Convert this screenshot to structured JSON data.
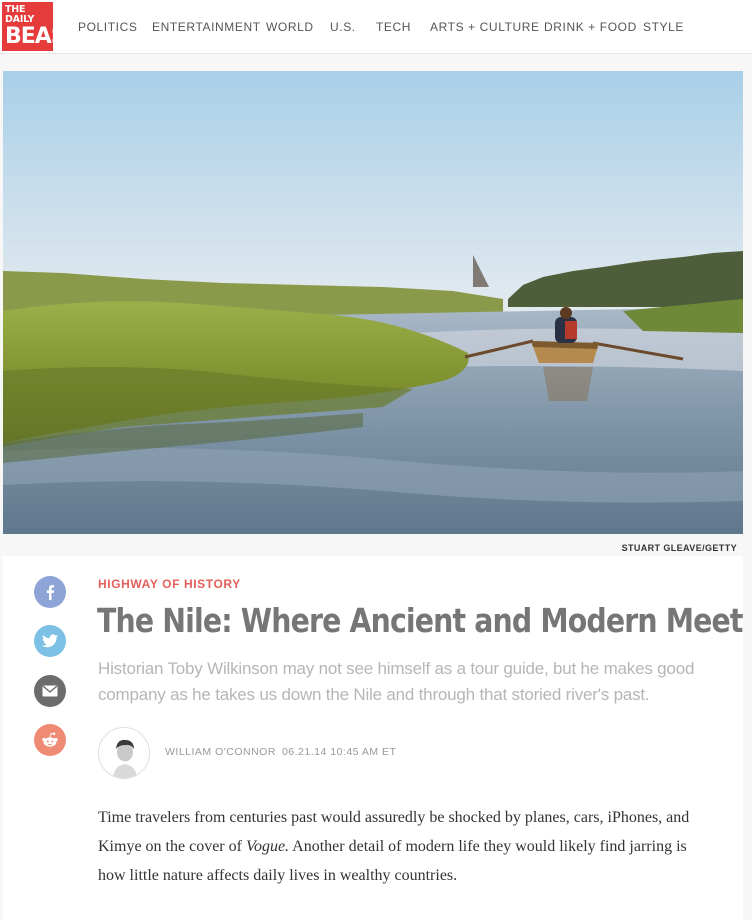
{
  "brand": {
    "line1": "THE DAILY",
    "line2": "BEAST"
  },
  "nav": [
    "POLITICS",
    "ENTERTAINMENT",
    "WORLD",
    "U.S.",
    "TECH",
    "ARTS + CULTURE",
    "DRINK + FOOD",
    "STYLE"
  ],
  "hero": {
    "credit": "STUART GLEAVE/GETTY"
  },
  "share": [
    {
      "name": "facebook-icon",
      "color": "#8ea4d6"
    },
    {
      "name": "twitter-icon",
      "color": "#7cc0e6"
    },
    {
      "name": "email-icon",
      "color": "#6c6c6c"
    },
    {
      "name": "reddit-icon",
      "color": "#ef8b74"
    }
  ],
  "article": {
    "kicker": "HIGHWAY OF HISTORY",
    "headline": "The Nile: Where Ancient and Modern Meet",
    "dek": "Historian Toby Wilkinson may not see himself as a tour guide, but he makes good company as he takes us down the Nile and through that storied river's past.",
    "author": "WILLIAM O'CONNOR",
    "date": "06.21.14 10:45 AM ET",
    "body_part1": "Time travelers from centuries past would assuredly be shocked by planes, cars, iPhones, and Kimye on the cover of ",
    "body_em": "Vogue.",
    "body_part2": " Another detail of modern life they would likely find jarring is how little nature affects daily lives in wealthy countries."
  },
  "colors": {
    "brand": "#e63b3b",
    "kicker": "#e5605a",
    "headline": "#767676",
    "dek": "#b6b6b6"
  }
}
